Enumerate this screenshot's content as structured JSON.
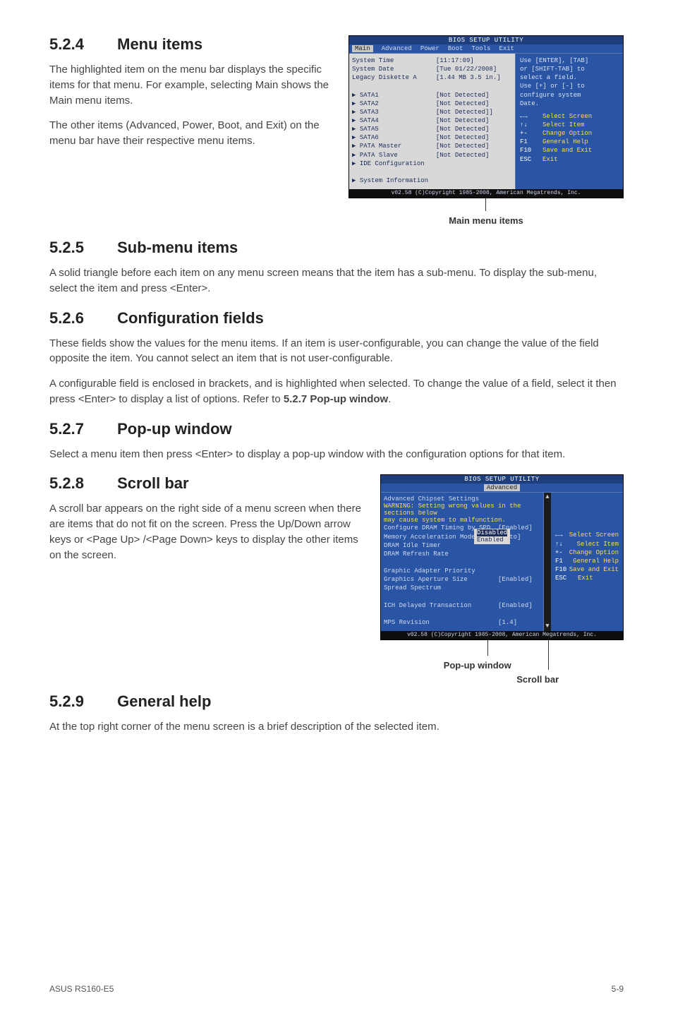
{
  "s524": {
    "num": "5.2.4",
    "title": "Menu items",
    "p1": "The highlighted item on the menu bar  displays the specific items for that menu. For example, selecting Main shows the Main menu items.",
    "p2": "The other items (Advanced, Power, Boot, and Exit) on the menu bar have their respective menu items."
  },
  "bios1": {
    "title": "BIOS SETUP UTILITY",
    "menu": {
      "main": "Main",
      "adv": "Advanced",
      "power": "Power",
      "boot": "Boot",
      "tools": "Tools",
      "exit": "Exit"
    },
    "left": [
      {
        "label": "System Time",
        "val": "[11:17:09]"
      },
      {
        "label": "System Date",
        "val": "[Tue 01/22/2008]"
      },
      {
        "label": "Legacy Diskette A",
        "val": "[1.44 MB 3.5 in.]"
      },
      {
        "label": "",
        "val": ""
      },
      {
        "label": "▶ SATA1",
        "val": "[Not Detected]"
      },
      {
        "label": "▶ SATA2",
        "val": "[Not Detected]"
      },
      {
        "label": "▶ SATA3",
        "val": "[Not Detected]]"
      },
      {
        "label": "▶ SATA4",
        "val": "[Not Detected]"
      },
      {
        "label": "▶ SATA5",
        "val": "[Not Detected]"
      },
      {
        "label": "▶ SATA6",
        "val": "[Not Detected]"
      },
      {
        "label": "▶ PATA Master",
        "val": "[Not Detected]"
      },
      {
        "label": "▶ PATA Slave",
        "val": "[Not Detected]"
      },
      {
        "label": "▶ IDE Configuration",
        "val": ""
      },
      {
        "label": "",
        "val": ""
      },
      {
        "label": "▶ System Information",
        "val": ""
      }
    ],
    "right_top": [
      "Use [ENTER], [TAB]",
      "or [SHIFT-TAB] to",
      "select a field.",
      "",
      "Use [+] or [-] to",
      "configure system",
      "Date."
    ],
    "right_keys": [
      {
        "k": "←→",
        "d": "Select Screen"
      },
      {
        "k": "↑↓",
        "d": "Select Item"
      },
      {
        "k": "+-",
        "d": "Change Option"
      },
      {
        "k": "F1",
        "d": "General Help"
      },
      {
        "k": "F10",
        "d": "Save and Exit"
      },
      {
        "k": "ESC",
        "d": "Exit"
      }
    ],
    "footer": "v02.58 (C)Copyright 1985-2008, American Megatrends, Inc.",
    "caption": "Main menu items"
  },
  "s525": {
    "num": "5.2.5",
    "title": "Sub-menu items",
    "p1": "A solid triangle before each item on any menu screen means that the item has a sub-menu. To display the sub-menu, select the item and press <Enter>."
  },
  "s526": {
    "num": "5.2.6",
    "title": "Configuration fields",
    "p1": "These fields show the values for the menu items. If an item is user-configurable, you can change the value of the field opposite the item. You cannot select an item that is not user-configurable.",
    "p2": "A configurable field is enclosed in brackets, and is highlighted when selected. To change the value of a field, select it then press <Enter> to display a list of options. Refer to ",
    "p2b": "5.2.7 Pop-up window",
    "p2c": "."
  },
  "s527": {
    "num": "5.2.7",
    "title": "Pop-up window",
    "p1": "Select a menu item then press <Enter> to display a pop-up window with the configuration options for that item."
  },
  "s528": {
    "num": "5.2.8",
    "title": "Scroll bar",
    "p1": "A scroll bar appears on the right side of a menu screen when there are items that do not fit on the screen. Press the Up/Down arrow keys or <Page Up> /<Page Down> keys to display the other items on the screen."
  },
  "bios2": {
    "title": "BIOS SETUP UTILITY",
    "menu": {
      "adv": "Advanced"
    },
    "heading": "Advanced Chipset Settings",
    "warn1": "WARNING: Setting wrong values in the sections below",
    "warn2": "         may cause system to malfunction.",
    "items": [
      {
        "l": "Configure DRAM Timing by SPD",
        "v": "[Enabled]"
      },
      {
        "l": "Memory Acceleration Mode",
        "v": "[Auto]"
      },
      {
        "l": "DRAM Idle Timer",
        "v": ""
      },
      {
        "l": "DRAM Refresh Rate",
        "v": ""
      },
      {
        "l": "",
        "v": ""
      },
      {
        "l": "Graphic Adapter Priority",
        "v": ""
      },
      {
        "l": "Graphics Aperture Size",
        "v": "[Enabled]"
      },
      {
        "l": "Spread Spectrum",
        "v": ""
      },
      {
        "l": "",
        "v": ""
      },
      {
        "l": "ICH Delayed Transaction",
        "v": "[Enabled]"
      },
      {
        "l": "",
        "v": ""
      },
      {
        "l": "MPS Revision",
        "v": "[1.4]"
      }
    ],
    "popup": [
      "Disabled",
      "Enabled"
    ],
    "right_keys": [
      {
        "k": "←→",
        "d": "Select Screen"
      },
      {
        "k": "↑↓",
        "d": "Select Item"
      },
      {
        "k": "+-",
        "d": "Change Option"
      },
      {
        "k": "F1",
        "d": "General Help"
      },
      {
        "k": "F10",
        "d": "Save and Exit"
      },
      {
        "k": "ESC",
        "d": "Exit"
      }
    ],
    "footer": "v02.58 (C)Copyright 1985-2008, American Megatrends, Inc.",
    "caption_popup": "Pop-up window",
    "caption_scroll": "Scroll bar"
  },
  "s529": {
    "num": "5.2.9",
    "title": "General help",
    "p1": "At the top right corner of the menu screen is a brief description of the selected item."
  },
  "footer": {
    "left": "ASUS RS160-E5",
    "right": "5-9"
  }
}
